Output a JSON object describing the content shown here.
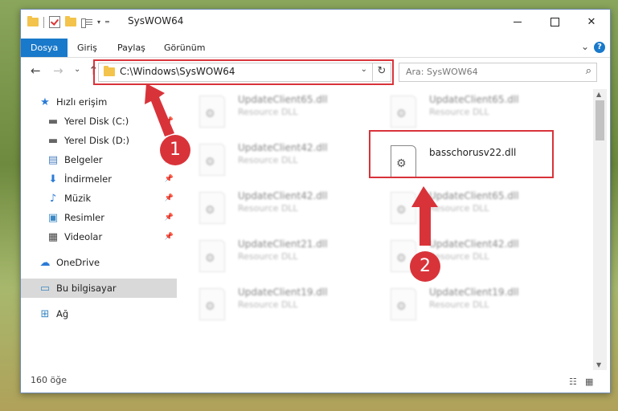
{
  "window": {
    "title": "SysWOW64"
  },
  "ribbon": {
    "tabs": [
      "Dosya",
      "Giriş",
      "Paylaş",
      "Görünüm"
    ],
    "help": "?"
  },
  "navbar": {
    "back": "←",
    "forward": "→",
    "recent": "⌄",
    "up": "↑",
    "address": "C:\\Windows\\SysWOW64",
    "search_placeholder": "Ara: SysWOW64"
  },
  "sidebar": {
    "items": [
      {
        "label": "Hızlı erişim",
        "icon": "star-icon"
      },
      {
        "label": "Yerel Disk (C:)",
        "icon": "drive-icon"
      },
      {
        "label": "Yerel Disk (D:)",
        "icon": "drive-icon"
      },
      {
        "label": "Belgeler",
        "icon": "document-icon"
      },
      {
        "label": "İndirmeler",
        "icon": "download-icon"
      },
      {
        "label": "Müzik",
        "icon": "music-icon"
      },
      {
        "label": "Resimler",
        "icon": "picture-icon"
      },
      {
        "label": "Videolar",
        "icon": "video-icon"
      },
      {
        "label": "OneDrive",
        "icon": "cloud-icon"
      },
      {
        "label": "Bu bilgisayar",
        "icon": "computer-icon"
      },
      {
        "label": "Ağ",
        "icon": "network-icon"
      }
    ]
  },
  "files": {
    "left": [
      {
        "name": "UpdateClient65.dll",
        "desc": "Resource DLL"
      },
      {
        "name": "UpdateClient42.dll",
        "desc": "Resource DLL"
      },
      {
        "name": "UpdateClient42.dll",
        "desc": "Resource DLL"
      },
      {
        "name": "UpdateClient21.dll",
        "desc": "Resource DLL"
      },
      {
        "name": "UpdateClient19.dll",
        "desc": "Resource DLL"
      }
    ],
    "right": [
      {
        "name": "UpdateClient65.dll",
        "desc": "Resource DLL"
      },
      {
        "name": "basschorusv22.dll",
        "desc": ""
      },
      {
        "name": "UpdateClient65.dll",
        "desc": "Resource DLL"
      },
      {
        "name": "UpdateClient42.dll",
        "desc": "Resource DLL"
      },
      {
        "name": "UpdateClient19.dll",
        "desc": "Resource DLL"
      }
    ]
  },
  "status": {
    "count": "160 öğe"
  },
  "annotations": {
    "badge1": "1",
    "badge2": "2",
    "color": "#d9333a"
  }
}
